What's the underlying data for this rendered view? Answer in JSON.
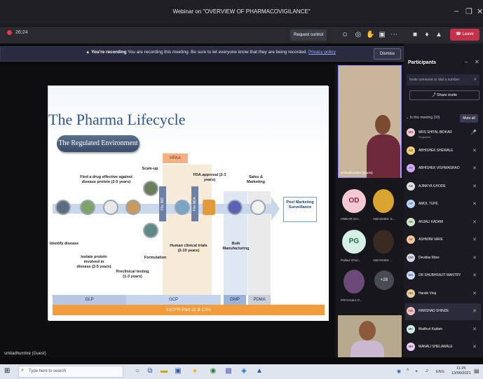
{
  "window": {
    "title": "Webinar on \"OVERVIEW OF PHARMACOVIGILANCE\"",
    "controls": [
      "–",
      "❐",
      "✕"
    ]
  },
  "toolbar": {
    "timer": "26:24",
    "request_control": "Request control",
    "leave": "Leave"
  },
  "banner": {
    "bold": "You're recording",
    "text": " You are recording this meeting. Be sure to let everyone know that they are being recorded. ",
    "link": "Privacy policy",
    "dismiss": "Dismiss"
  },
  "slide": {
    "title": "The Pharma Lifecycle",
    "subtitle": "The Regulated Environment",
    "labels": {
      "find_drug": "Find a drug effective against disease protein (2-5 years)",
      "scaleup": "Scale-up",
      "hpaa": "HPAA",
      "fda": "FDA approval (2-3 years)",
      "sales": "Sales & Marketing",
      "post": "Post Marketing Surveillance",
      "identify": "Identify disease",
      "isolate": "Isolate protein involved in disease (2-5 years)",
      "preclinical": "Preclinical testing (1-3 years)",
      "formulation": "Formulation",
      "clinical": "Human clinical trials (2-10 years)",
      "bulk": "Bulk Manufacturing",
      "file_ind": "File IND",
      "file_nda": "File NDA"
    },
    "bands": {
      "glp": "GLP",
      "gcp": "GCP",
      "gmp": "GMP",
      "pdma": "PDMA"
    },
    "footer": "21CFR Part 11 & CSV"
  },
  "stage_name": "smitadhumbre (Guest)",
  "rail": {
    "presenter_name": "smitadhumbre (Guest)",
    "tiles": [
      {
        "initials": "OD",
        "name": "OMKAR DH..."
      },
      {
        "initials": "",
        "name": "ABHISHEK S..."
      },
      {
        "initials": "PG",
        "name": "Pallavi Ghol..."
      },
      {
        "initials": "",
        "name": "ABHISHEK ..."
      },
      {
        "initials": "",
        "name": "PRIYANKA P..."
      },
      {
        "initials": "+28",
        "name": ""
      }
    ]
  },
  "participants": {
    "title": "Participants",
    "invite_placeholder": "Invite someone or dial a number",
    "share_invite": "Share invite",
    "in_meeting": "In this meeting (33)",
    "mute_all": "Mute all",
    "people": [
      {
        "initials": "MS",
        "name": "MRS SHITAL BIDKAR",
        "role": "Organizer",
        "mic": "🎤"
      },
      {
        "initials": "AS",
        "name": "ABHISHEK SHEWALE",
        "mic": "✕"
      },
      {
        "initials": "AV",
        "name": "ABHISHEK VISHWASRAO",
        "mic": "✕"
      },
      {
        "initials": "AG",
        "name": "AJINKYA GHODE",
        "mic": "✕"
      },
      {
        "initials": "AT",
        "name": "AMOL TUPE",
        "mic": "✕"
      },
      {
        "initials": "AK",
        "name": "ANJALI KADAM",
        "mic": "✕"
      },
      {
        "initials": "AV",
        "name": "ASHWINI VARE",
        "mic": "✕"
      },
      {
        "initials": "DM",
        "name": "Devidas More",
        "mic": "✕"
      },
      {
        "initials": "DS",
        "name": "DR SHUBHRAJIT MANTRY",
        "mic": "✕"
      },
      {
        "initials": "HV",
        "name": "Hande Viraj",
        "mic": "✕"
      },
      {
        "initials": "HS",
        "name": "HARSHAD SHINDE",
        "mic": "✕"
      },
      {
        "initials": "MK",
        "name": "Madhuri Kadam",
        "mic": "✕"
      },
      {
        "initials": "MS",
        "name": "MANALI SHELAWALE",
        "mic": "✕"
      }
    ]
  },
  "taskbar": {
    "search_placeholder": "Type here to search",
    "time": "11:25",
    "date": "13/06/2021",
    "lang": "ENG"
  }
}
